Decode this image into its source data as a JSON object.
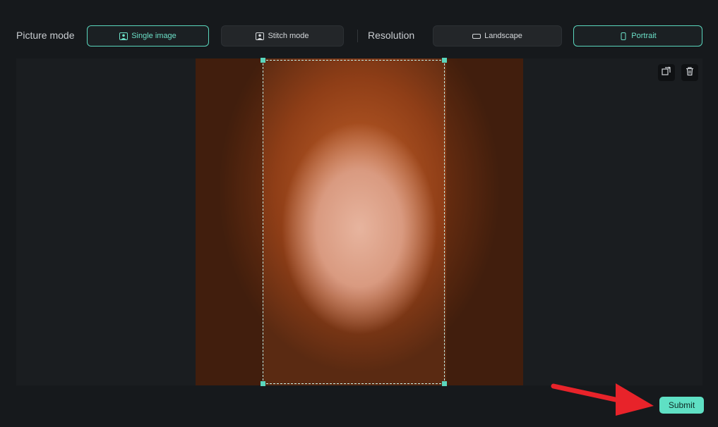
{
  "toolbar": {
    "picture_mode_label": "Picture mode",
    "resolution_label": "Resolution",
    "single_image": {
      "label": "Single image",
      "icon": "image-icon",
      "active": true
    },
    "stitch_mode": {
      "label": "Stitch mode",
      "icon": "portrait-icon",
      "active": false
    },
    "landscape": {
      "label": "Landscape",
      "icon": "landscape-rect-icon",
      "active": false
    },
    "portrait": {
      "label": "Portrait",
      "icon": "portrait-rect-icon",
      "active": true
    }
  },
  "canvas": {
    "tools": [
      "replace-image-icon",
      "trash-icon"
    ]
  },
  "footer": {
    "submit_label": "Submit"
  },
  "colors": {
    "accent": "#5ad6bd",
    "submit_bg": "#5fe0c4",
    "background": "#16191c",
    "annotation_arrow": "#e8232a"
  }
}
